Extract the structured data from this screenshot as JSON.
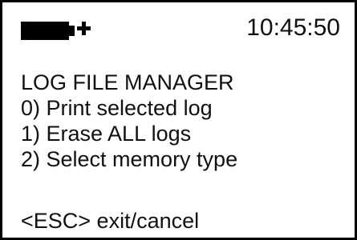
{
  "status": {
    "battery_icon": "battery-charging-icon",
    "time": "10:45:50"
  },
  "menu": {
    "title": "LOG FILE MANAGER",
    "items": [
      {
        "label": "0) Print selected log"
      },
      {
        "label": "1) Erase ALL logs"
      },
      {
        "label": "2) Select memory type"
      }
    ]
  },
  "footer": {
    "hint": "<ESC>  exit/cancel"
  },
  "colors": {
    "background": "#ffffff",
    "foreground": "#000000"
  }
}
